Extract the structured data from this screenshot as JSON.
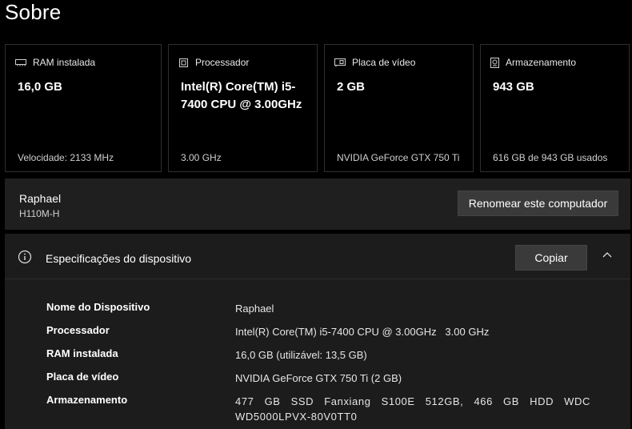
{
  "page": {
    "title": "Sobre"
  },
  "cards": [
    {
      "icon": "ram-icon",
      "label": "RAM instalada",
      "value": "16,0 GB",
      "foot": "Velocidade: 2133 MHz"
    },
    {
      "icon": "processor-icon",
      "label": "Processador",
      "value": "Intel(R) Core(TM) i5-7400 CPU @ 3.00GHz",
      "foot": "3.00 GHz"
    },
    {
      "icon": "gpu-icon",
      "label": "Placa de vídeo",
      "value": "2 GB",
      "foot": "NVIDIA GeForce GTX 750 Ti"
    },
    {
      "icon": "storage-icon",
      "label": "Armazenamento",
      "value": "943 GB",
      "foot": "616 GB de 943 GB usados"
    }
  ],
  "rename": {
    "name": "Raphael",
    "model": "H110M-H",
    "button": "Renomear este computador"
  },
  "specs": {
    "header": "Especificações do dispositivo",
    "copy_button": "Copiar",
    "rows": [
      {
        "key": "Nome do Dispositivo",
        "value": "Raphael"
      },
      {
        "key": "Processador",
        "value": "Intel(R) Core(TM) i5-7400 CPU @ 3.00GHz   3.00 GHz"
      },
      {
        "key": "RAM instalada",
        "value": "16,0 GB (utilizável: 13,5 GB)"
      },
      {
        "key": "Placa de vídeo",
        "value": "NVIDIA GeForce GTX 750 Ti (2 GB)"
      },
      {
        "key": "Armazenamento",
        "value": "477 GB SSD Fanxiang S100E 512GB, 466 GB HDD WDC WD5000LPVX-80V0TT0"
      }
    ]
  }
}
